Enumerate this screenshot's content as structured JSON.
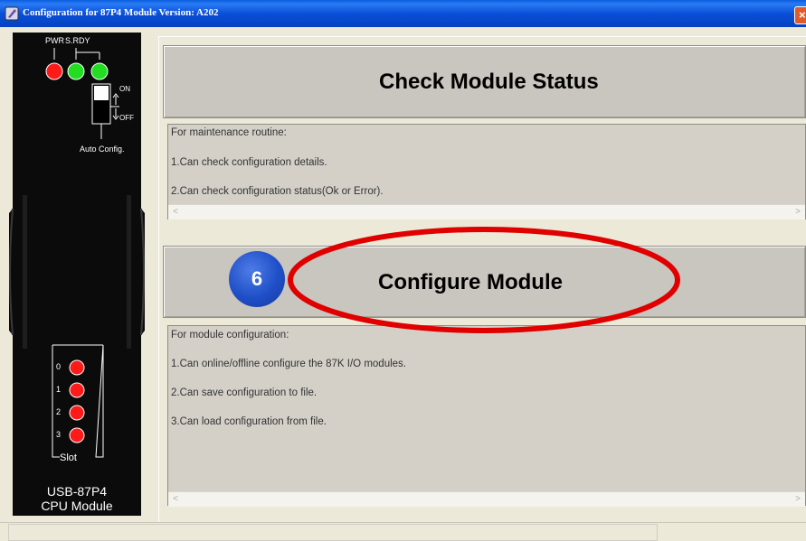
{
  "window": {
    "title": "Configuration for 87P4 Module Version: A202",
    "close_glyph": "×"
  },
  "module_panel": {
    "pwr_label": "PWR",
    "srdy_label": "S.RDY",
    "switch_on_label": "ON",
    "switch_off_label": "OFF",
    "auto_config_label": "Auto Config.",
    "slots": [
      "0",
      "1",
      "2",
      "3"
    ],
    "slot_label": "Slot",
    "model": "USB-87P4",
    "cpu_label": "CPU Module",
    "led_colors": {
      "pwr": "#ff1a1a",
      "ok": "#22dd22",
      "slot": "#ff1a1a"
    }
  },
  "check_status": {
    "button_label": "Check Module Status",
    "lines": [
      "For maintenance routine:",
      "1.Can check configuration details.",
      "2.Can check configuration status(Ok or Error)."
    ]
  },
  "configure": {
    "button_label": "Configure Module",
    "lines": [
      "For module configuration:",
      "1.Can online/offline configure the 87K I/O modules.",
      "2.Can save configuration to file.",
      "3.Can load configuration from file."
    ]
  },
  "annotation": {
    "step_number": "6",
    "badge_color": "#1f4fc8",
    "ellipse_color": "#e00000"
  },
  "scroll_arrows": {
    "left": "<",
    "right": ">"
  }
}
